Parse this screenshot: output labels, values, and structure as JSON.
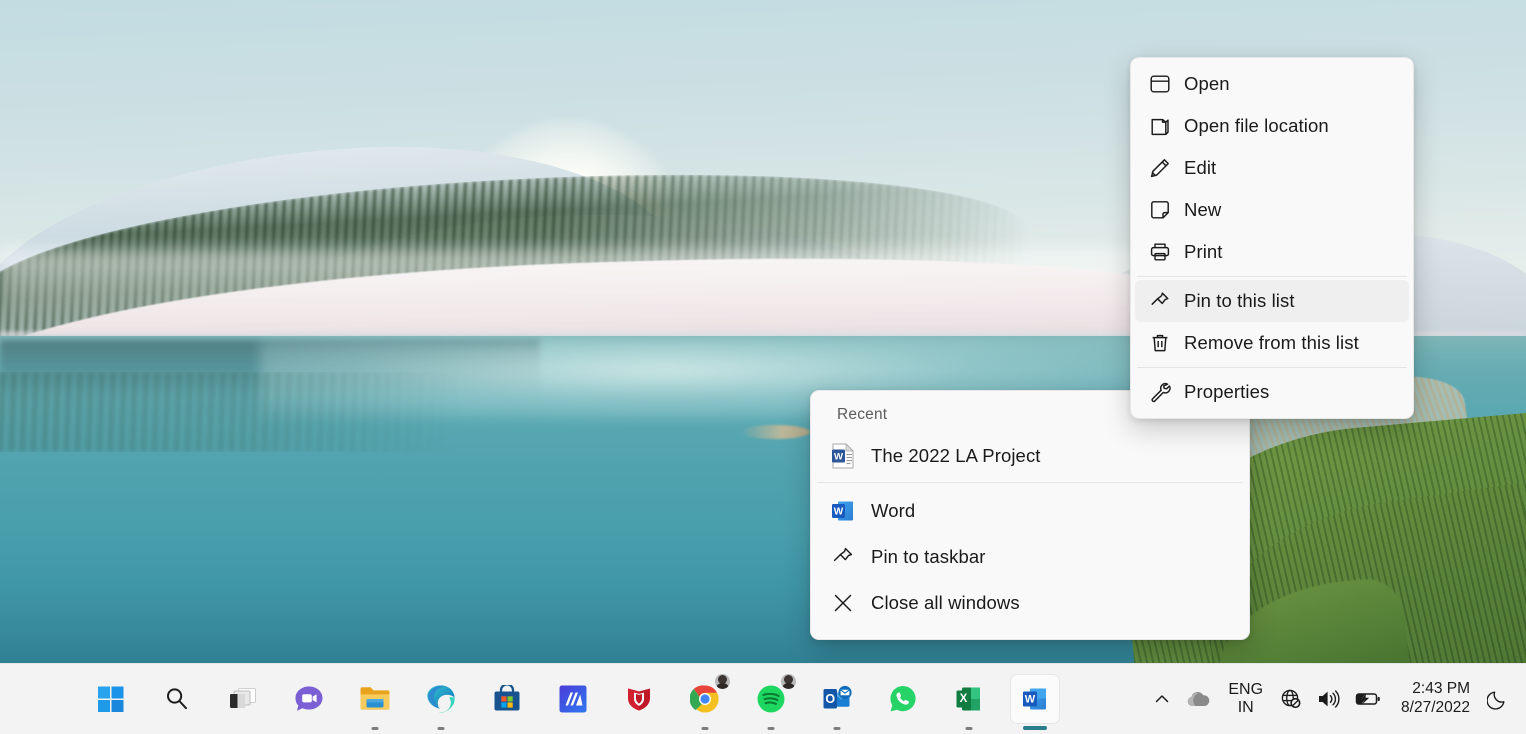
{
  "desktop": {
    "wallpaper_name": "windows-11-sunrise-lake",
    "colors": {
      "sky": "#c9dde2",
      "water": "#4fa2ae",
      "grass": "#5e8a3c",
      "snow": "#eee4e6",
      "taskbar": "#f3f3f3",
      "menu_surface": "#f9f9f9",
      "menu_highlight": "#efefef",
      "accent": "#0078d4",
      "active_indicator": "#2c7d8c"
    }
  },
  "context_menu": {
    "name": "jump-list-item-context-menu",
    "items": [
      {
        "label": "Open",
        "icon": "window-icon",
        "highlighted": false,
        "separator_after": false
      },
      {
        "label": "Open file location",
        "icon": "folder-icon",
        "highlighted": false,
        "separator_after": false
      },
      {
        "label": "Edit",
        "icon": "pencil-icon",
        "highlighted": false,
        "separator_after": false
      },
      {
        "label": "New",
        "icon": "new-document-icon",
        "highlighted": false,
        "separator_after": false
      },
      {
        "label": "Print",
        "icon": "printer-icon",
        "highlighted": false,
        "separator_after": true
      },
      {
        "label": "Pin to this list",
        "icon": "pin-icon",
        "highlighted": true,
        "separator_after": false
      },
      {
        "label": "Remove from this list",
        "icon": "trash-icon",
        "highlighted": false,
        "separator_after": true
      },
      {
        "label": "Properties",
        "icon": "wrench-icon",
        "highlighted": false,
        "separator_after": false
      }
    ]
  },
  "jump_list": {
    "name": "word-taskbar-jump-list",
    "section_header": "Recent",
    "recent_items": [
      {
        "label": "The 2022 LA Project",
        "icon": "word-document-icon"
      }
    ],
    "actions": [
      {
        "label": "Word",
        "icon": "word-app-icon"
      },
      {
        "label": "Pin to taskbar",
        "icon": "pin-icon"
      },
      {
        "label": "Close all windows",
        "icon": "close-x-icon"
      }
    ]
  },
  "taskbar": {
    "apps": [
      {
        "name": "start",
        "label": "Start",
        "icon": "windows-start-icon",
        "running": false,
        "active": false
      },
      {
        "name": "search",
        "label": "Search",
        "icon": "search-icon",
        "running": false,
        "active": false
      },
      {
        "name": "task-view",
        "label": "Task View",
        "icon": "task-view-icon",
        "running": false,
        "active": false
      },
      {
        "name": "chat",
        "label": "Chat",
        "icon": "chat-teams-icon",
        "running": false,
        "active": false
      },
      {
        "name": "file-explorer",
        "label": "File Explorer",
        "icon": "file-explorer-icon",
        "running": true,
        "active": false
      },
      {
        "name": "edge",
        "label": "Microsoft Edge",
        "icon": "edge-icon",
        "running": true,
        "active": false
      },
      {
        "name": "store",
        "label": "Microsoft Store",
        "icon": "store-icon",
        "running": false,
        "active": false
      },
      {
        "name": "movies-anywhere",
        "label": "M App",
        "icon": "m-app-icon",
        "running": false,
        "active": false
      },
      {
        "name": "mcafee",
        "label": "McAfee",
        "icon": "mcafee-icon",
        "running": false,
        "active": false
      },
      {
        "name": "chrome",
        "label": "Google Chrome",
        "icon": "chrome-icon",
        "running": true,
        "active": false,
        "badge": "avatar"
      },
      {
        "name": "spotify",
        "label": "Spotify",
        "icon": "spotify-icon",
        "running": true,
        "active": false,
        "badge": "avatar"
      },
      {
        "name": "outlook",
        "label": "Outlook",
        "icon": "outlook-icon",
        "running": true,
        "active": false
      },
      {
        "name": "whatsapp",
        "label": "WhatsApp",
        "icon": "whatsapp-icon",
        "running": false,
        "active": false
      },
      {
        "name": "excel",
        "label": "Microsoft Excel",
        "icon": "excel-icon",
        "running": true,
        "active": false
      },
      {
        "name": "word",
        "label": "Microsoft Word",
        "icon": "word-app-icon",
        "running": true,
        "active": true
      }
    ],
    "tray": {
      "overflow_icon": "chevron-up-icon",
      "onedrive_icon": "onedrive-cloud-icon",
      "language": {
        "primary": "ENG",
        "secondary": "IN"
      },
      "network_icon": "globe-no-internet-icon",
      "volume_icon": "speaker-icon",
      "battery_icon": "battery-charging-icon",
      "clock": {
        "time": "2:43 PM",
        "date": "8/27/2022"
      },
      "notifications_icon": "moon-icon"
    }
  }
}
